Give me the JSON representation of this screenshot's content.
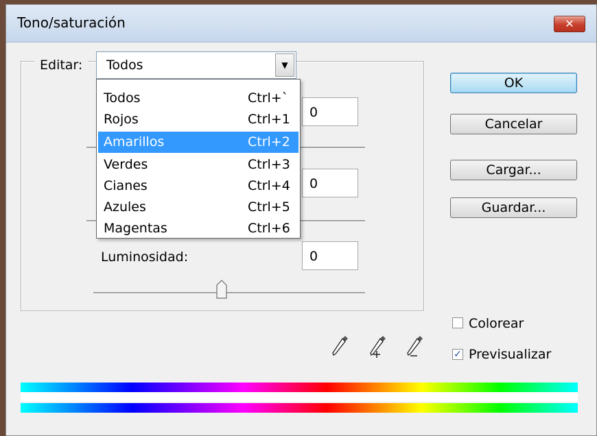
{
  "dialog": {
    "title": "Tono/saturación",
    "close_label": "✕"
  },
  "edit": {
    "label": "Editar:",
    "selected": "Todos",
    "options": [
      {
        "label": "Todos",
        "shortcut": "Ctrl+`"
      },
      {
        "label": "Rojos",
        "shortcut": "Ctrl+1"
      },
      {
        "label": "Amarillos",
        "shortcut": "Ctrl+2"
      },
      {
        "label": "Verdes",
        "shortcut": "Ctrl+3"
      },
      {
        "label": "Cianes",
        "shortcut": "Ctrl+4"
      },
      {
        "label": "Azules",
        "shortcut": "Ctrl+5"
      },
      {
        "label": "Magentas",
        "shortcut": "Ctrl+6"
      }
    ],
    "highlighted_index": 2
  },
  "fields": {
    "hue_value": "0",
    "saturation_value": "0",
    "lightness_label": "Luminosidad:",
    "lightness_value": "0"
  },
  "buttons": {
    "ok": "OK",
    "cancel": "Cancelar",
    "load": "Cargar...",
    "save": "Guardar..."
  },
  "options": {
    "colorize_label": "Colorear",
    "colorize_checked": false,
    "preview_label": "Previsualizar",
    "preview_checked": true
  },
  "icons": [
    "eyedropper-icon",
    "eyedropper-plus-icon",
    "eyedropper-minus-icon"
  ]
}
